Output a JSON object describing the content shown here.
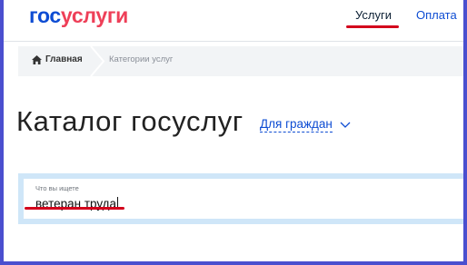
{
  "header": {
    "logo_part1": "гос",
    "logo_part2": "услуги",
    "nav": {
      "services_label": "Услуги",
      "payment_label": "Оплата"
    }
  },
  "breadcrumb": {
    "home_label": "Главная",
    "current_label": "Категории услуг"
  },
  "main": {
    "title": "Каталог госуслуг",
    "audience_label": "Для граждан"
  },
  "search": {
    "label": "Что вы ищете",
    "value": "ветеран труда"
  },
  "colors": {
    "brand_blue": "#0d4cd3",
    "brand_red": "#ee3f58",
    "annotation_red": "#d3001c",
    "frame": "#4a4fcf",
    "search_bg": "#cfe6f8"
  },
  "icons": [
    "home-icon",
    "chevron-down-icon"
  ]
}
